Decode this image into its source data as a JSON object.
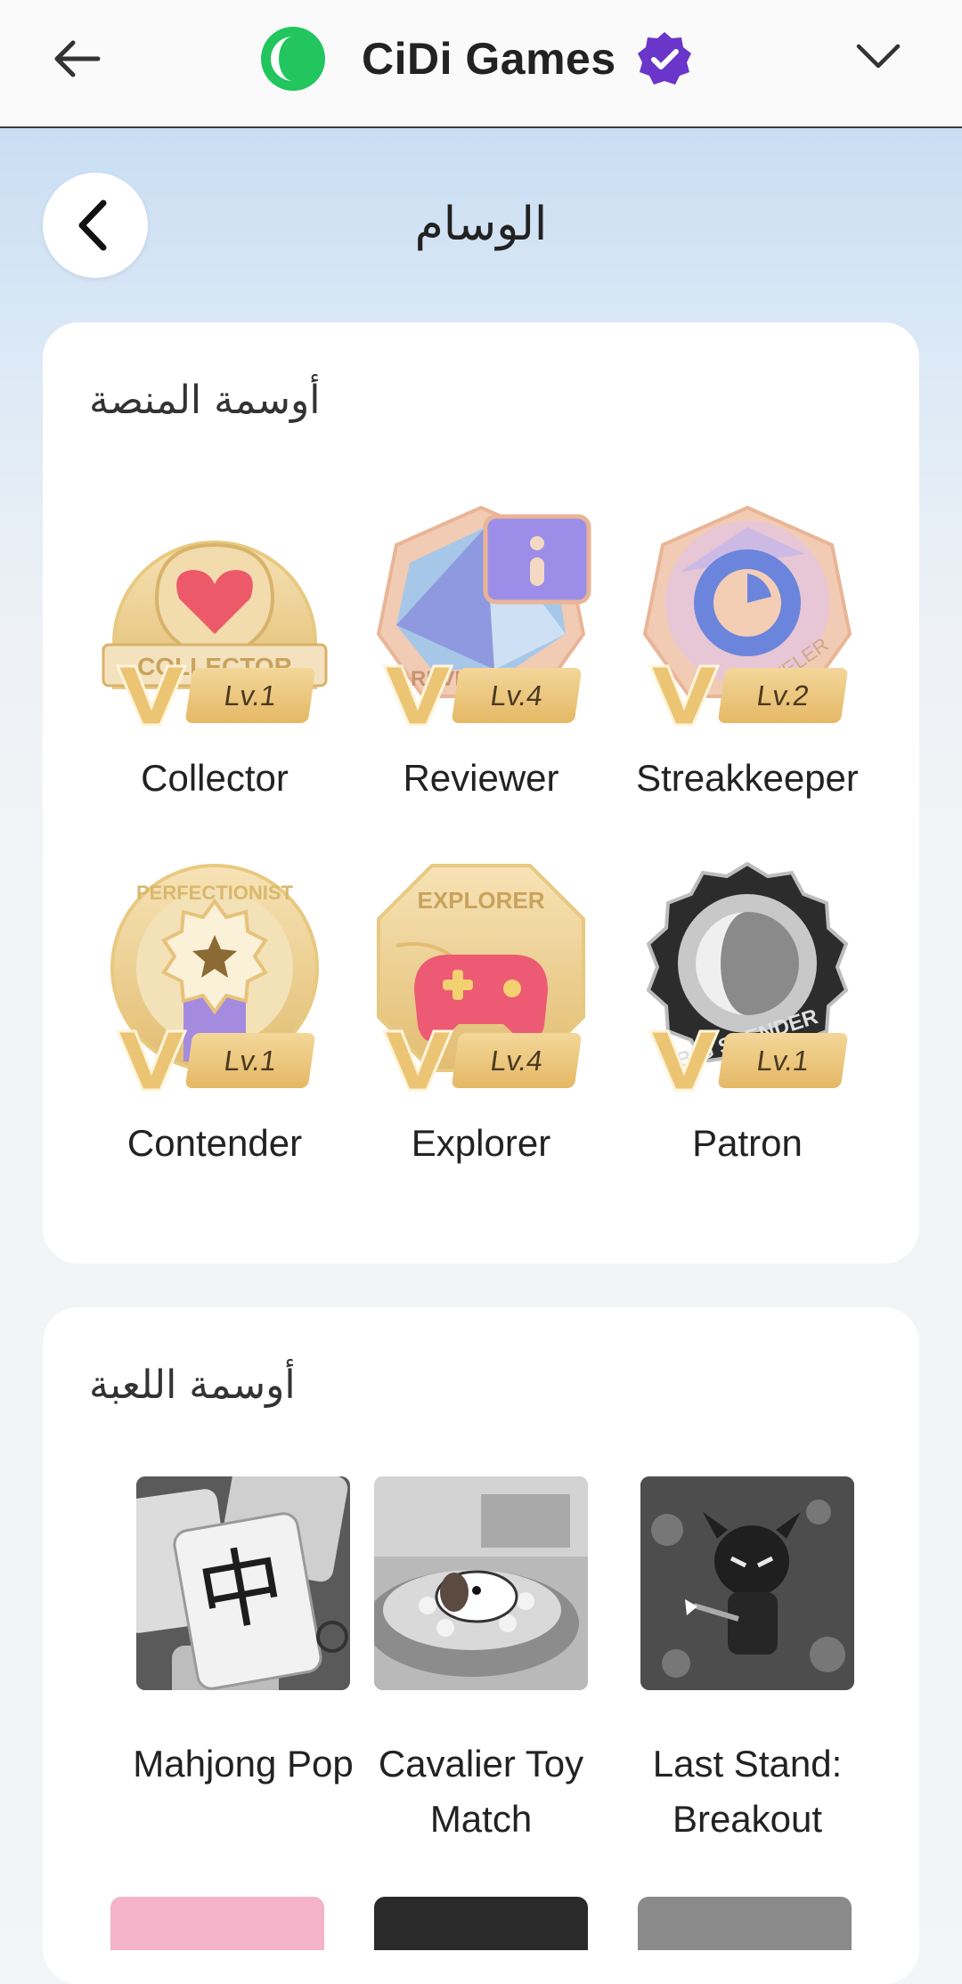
{
  "header": {
    "brand_name": "CiDi Games",
    "accent": "#28c76f",
    "verified_color": "#6a35c9"
  },
  "page": {
    "title": "الوسام"
  },
  "platform_section": {
    "title": "أوسمة المنصة",
    "badges": [
      {
        "name": "Collector",
        "level": "Lv.1",
        "icon": "heart-badge-icon",
        "banner": "COLLECTOR"
      },
      {
        "name": "Reviewer",
        "level": "Lv.4",
        "icon": "reviewer-badge-icon",
        "banner": "REVIEWER"
      },
      {
        "name": "Streakkeeper",
        "level": "Lv.2",
        "icon": "traveler-badge-icon",
        "banner": "TRAVELER"
      },
      {
        "name": "Contender",
        "level": "Lv.1",
        "icon": "perfectionist-badge-icon",
        "banner": "PERFECTIONIST"
      },
      {
        "name": "Explorer",
        "level": "Lv.4",
        "icon": "explorer-badge-icon",
        "banner": "EXPLORER"
      },
      {
        "name": "Patron",
        "level": "Lv.1",
        "icon": "big-spender-badge-icon",
        "banner": "BIG SPENDER"
      }
    ]
  },
  "game_section": {
    "title": "أوسمة اللعبة",
    "games": [
      {
        "name": "Mahjong Pop"
      },
      {
        "name": "Cavalier Toy Match"
      },
      {
        "name": "Last Stand: Breakout"
      }
    ]
  }
}
